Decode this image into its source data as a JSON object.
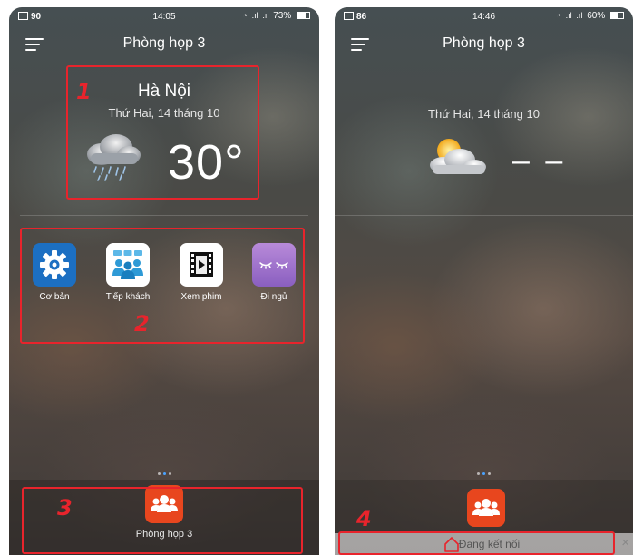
{
  "left_screen": {
    "status_bar": {
      "notification": "90",
      "time": "14:05",
      "battery": "73%",
      "battery_level": 0.73
    },
    "header": {
      "title": "Phòng họp 3",
      "menu_icon": "hamburger-menu-icon"
    },
    "weather": {
      "city": "Hà Nội",
      "date": "Thứ Hai, 14 tháng 10",
      "temperature": "30°",
      "icon": "rain-cloud-icon"
    },
    "shortcuts": [
      {
        "label": "Cơ bản",
        "icon": "gear-icon",
        "color": "#1c6fc2"
      },
      {
        "label": "Tiếp khách",
        "icon": "group-meeting-icon",
        "color": "#ffffff"
      },
      {
        "label": "Xem phim",
        "icon": "film-icon",
        "color": "#ffffff"
      },
      {
        "label": "Đi ngủ",
        "icon": "sleep-eyes-icon",
        "color": "#9b6fc7"
      }
    ],
    "dock": {
      "room_label": "Phòng họp 3",
      "room_icon": "people-group-icon",
      "room_color": "#e8461e"
    }
  },
  "right_screen": {
    "status_bar": {
      "notification": "86",
      "time": "14:46",
      "battery": "60%",
      "battery_level": 0.6
    },
    "header": {
      "title": "Phòng họp 3",
      "menu_icon": "hamburger-menu-icon"
    },
    "weather": {
      "date": "Thứ Hai, 14 tháng 10",
      "temperature": "– –",
      "icon": "sun-cloud-icon"
    },
    "dock": {
      "room_icon": "people-group-icon",
      "room_color": "#e8461e"
    },
    "connection_strip": {
      "text": "Đang kết nối",
      "icon": "home-outline-icon",
      "close": "×"
    }
  },
  "annotations": {
    "color": "#e8242c",
    "labels": [
      "1",
      "2",
      "3",
      "4"
    ]
  }
}
